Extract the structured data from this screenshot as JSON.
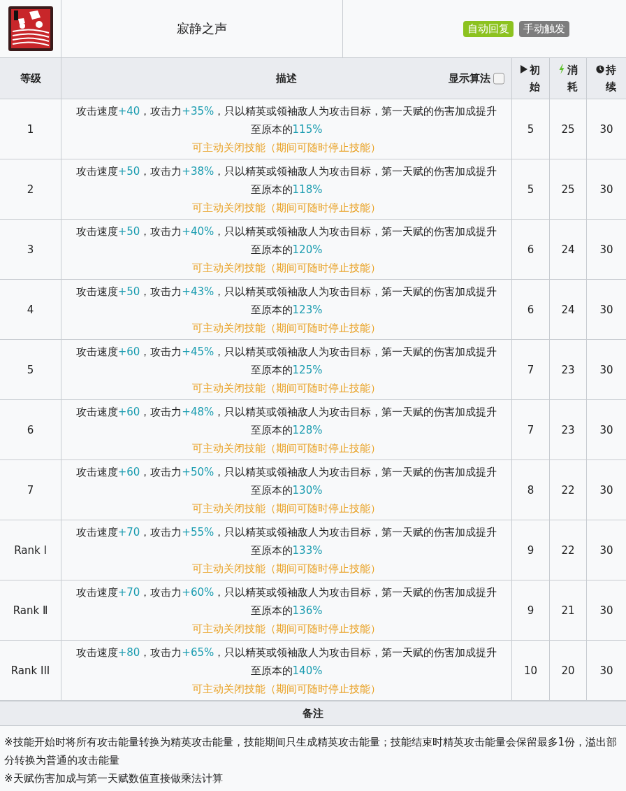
{
  "skill": {
    "name": "寂静之声",
    "tags": [
      {
        "label": "自动回复",
        "color": "#8cc21f"
      },
      {
        "label": "手动触发",
        "color": "#7d7d7d"
      }
    ]
  },
  "table": {
    "columns": [
      {
        "label": "等级"
      },
      {
        "label": "描述"
      },
      {
        "label": "初始",
        "kind": "play"
      },
      {
        "label": "消耗",
        "kind": "bolt"
      },
      {
        "label": "持续",
        "kind": "clock"
      }
    ],
    "formula_toggle": {
      "label": "显示算法",
      "checked": false
    },
    "rows": [
      {
        "level": "1",
        "description": [
          {
            "kind": "plain",
            "text": "攻击速度"
          },
          {
            "kind": "value",
            "text": "+40"
          },
          {
            "kind": "plain",
            "text": "，攻击力"
          },
          {
            "kind": "value",
            "text": "+35%"
          },
          {
            "kind": "plain",
            "text": "，只以精英或领袖敌人为攻击目标，第一天赋的伤害加成提升至原本的"
          },
          {
            "kind": "value",
            "text": "115%"
          }
        ],
        "note": "可主动关闭技能（期间可随时停止技能）",
        "initial": "5",
        "cost": "25",
        "duration": "30"
      },
      {
        "level": "2",
        "description": [
          {
            "kind": "plain",
            "text": "攻击速度"
          },
          {
            "kind": "value",
            "text": "+50"
          },
          {
            "kind": "plain",
            "text": "，攻击力"
          },
          {
            "kind": "value",
            "text": "+38%"
          },
          {
            "kind": "plain",
            "text": "，只以精英或领袖敌人为攻击目标，第一天赋的伤害加成提升至原本的"
          },
          {
            "kind": "value",
            "text": "118%"
          }
        ],
        "note": "可主动关闭技能（期间可随时停止技能）",
        "initial": "5",
        "cost": "25",
        "duration": "30"
      },
      {
        "level": "3",
        "description": [
          {
            "kind": "plain",
            "text": "攻击速度"
          },
          {
            "kind": "value",
            "text": "+50"
          },
          {
            "kind": "plain",
            "text": "，攻击力"
          },
          {
            "kind": "value",
            "text": "+40%"
          },
          {
            "kind": "plain",
            "text": "，只以精英或领袖敌人为攻击目标，第一天赋的伤害加成提升至原本的"
          },
          {
            "kind": "value",
            "text": "120%"
          }
        ],
        "note": "可主动关闭技能（期间可随时停止技能）",
        "initial": "6",
        "cost": "24",
        "duration": "30"
      },
      {
        "level": "4",
        "description": [
          {
            "kind": "plain",
            "text": "攻击速度"
          },
          {
            "kind": "value",
            "text": "+50"
          },
          {
            "kind": "plain",
            "text": "，攻击力"
          },
          {
            "kind": "value",
            "text": "+43%"
          },
          {
            "kind": "plain",
            "text": "，只以精英或领袖敌人为攻击目标，第一天赋的伤害加成提升至原本的"
          },
          {
            "kind": "value",
            "text": "123%"
          }
        ],
        "note": "可主动关闭技能（期间可随时停止技能）",
        "initial": "6",
        "cost": "24",
        "duration": "30"
      },
      {
        "level": "5",
        "description": [
          {
            "kind": "plain",
            "text": "攻击速度"
          },
          {
            "kind": "value",
            "text": "+60"
          },
          {
            "kind": "plain",
            "text": "，攻击力"
          },
          {
            "kind": "value",
            "text": "+45%"
          },
          {
            "kind": "plain",
            "text": "，只以精英或领袖敌人为攻击目标，第一天赋的伤害加成提升至原本的"
          },
          {
            "kind": "value",
            "text": "125%"
          }
        ],
        "note": "可主动关闭技能（期间可随时停止技能）",
        "initial": "7",
        "cost": "23",
        "duration": "30"
      },
      {
        "level": "6",
        "description": [
          {
            "kind": "plain",
            "text": "攻击速度"
          },
          {
            "kind": "value",
            "text": "+60"
          },
          {
            "kind": "plain",
            "text": "，攻击力"
          },
          {
            "kind": "value",
            "text": "+48%"
          },
          {
            "kind": "plain",
            "text": "，只以精英或领袖敌人为攻击目标，第一天赋的伤害加成提升至原本的"
          },
          {
            "kind": "value",
            "text": "128%"
          }
        ],
        "note": "可主动关闭技能（期间可随时停止技能）",
        "initial": "7",
        "cost": "23",
        "duration": "30"
      },
      {
        "level": "7",
        "description": [
          {
            "kind": "plain",
            "text": "攻击速度"
          },
          {
            "kind": "value",
            "text": "+60"
          },
          {
            "kind": "plain",
            "text": "，攻击力"
          },
          {
            "kind": "value",
            "text": "+50%"
          },
          {
            "kind": "plain",
            "text": "，只以精英或领袖敌人为攻击目标，第一天赋的伤害加成提升至原本的"
          },
          {
            "kind": "value",
            "text": "130%"
          }
        ],
        "note": "可主动关闭技能（期间可随时停止技能）",
        "initial": "8",
        "cost": "22",
        "duration": "30"
      },
      {
        "level": "Rank Ⅰ",
        "description": [
          {
            "kind": "plain",
            "text": "攻击速度"
          },
          {
            "kind": "value",
            "text": "+70"
          },
          {
            "kind": "plain",
            "text": "，攻击力"
          },
          {
            "kind": "value",
            "text": "+55%"
          },
          {
            "kind": "plain",
            "text": "，只以精英或领袖敌人为攻击目标，第一天赋的伤害加成提升至原本的"
          },
          {
            "kind": "value",
            "text": "133%"
          }
        ],
        "note": "可主动关闭技能（期间可随时停止技能）",
        "initial": "9",
        "cost": "22",
        "duration": "30"
      },
      {
        "level": "Rank Ⅱ",
        "description": [
          {
            "kind": "plain",
            "text": "攻击速度"
          },
          {
            "kind": "value",
            "text": "+70"
          },
          {
            "kind": "plain",
            "text": "，攻击力"
          },
          {
            "kind": "value",
            "text": "+60%"
          },
          {
            "kind": "plain",
            "text": "，只以精英或领袖敌人为攻击目标，第一天赋的伤害加成提升至原本的"
          },
          {
            "kind": "value",
            "text": "136%"
          }
        ],
        "note": "可主动关闭技能（期间可随时停止技能）",
        "initial": "9",
        "cost": "21",
        "duration": "30"
      },
      {
        "level": "Rank III",
        "description": [
          {
            "kind": "plain",
            "text": "攻击速度"
          },
          {
            "kind": "value",
            "text": "+80"
          },
          {
            "kind": "plain",
            "text": "，攻击力"
          },
          {
            "kind": "value",
            "text": "+65%"
          },
          {
            "kind": "plain",
            "text": "，只以精英或领袖敌人为攻击目标，第一天赋的伤害加成提升至原本的"
          },
          {
            "kind": "value",
            "text": "140%"
          }
        ],
        "note": "可主动关闭技能（期间可随时停止技能）",
        "initial": "10",
        "cost": "20",
        "duration": "30"
      }
    ]
  },
  "remarks": {
    "title": "备注",
    "lines": [
      "※技能开始时将所有攻击能量转换为精英攻击能量，技能期间只生成精英攻击能量；技能结束时精英攻击能量会保留最多1份，溢出部分转换为普通的攻击能量",
      "※天赋伤害加成与第一天赋数值直接做乘法计算"
    ]
  }
}
